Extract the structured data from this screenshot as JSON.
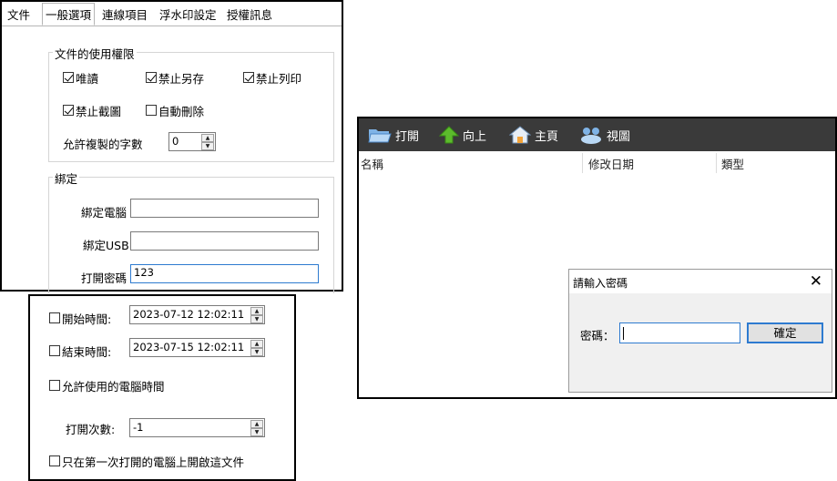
{
  "settings": {
    "tabs": [
      {
        "label": "文件"
      },
      {
        "label": "一般選項"
      },
      {
        "label": "連線項目"
      },
      {
        "label": "浮水印設定"
      },
      {
        "label": "授權訊息"
      }
    ],
    "active_tab": "一般選項",
    "permissions": {
      "legend": "文件的使用權限",
      "read_only": {
        "label": "唯讀",
        "checked": true
      },
      "no_save_as": {
        "label": "禁止另存",
        "checked": true
      },
      "no_print": {
        "label": "禁止列印",
        "checked": true
      },
      "no_screenshot": {
        "label": "禁止截圖",
        "checked": true
      },
      "auto_delete": {
        "label": "自動刪除",
        "checked": false
      },
      "copy_chars_label": "允許複製的字數",
      "copy_chars_value": "0"
    },
    "binding": {
      "legend": "綁定",
      "bind_pc_label": "綁定電腦",
      "bind_pc_value": "",
      "bind_usb_label": "綁定USB",
      "bind_usb_value": "",
      "open_pw_label": "打開密碼",
      "open_pw_value": "123"
    }
  },
  "time_panel": {
    "start_label": "開始時間:",
    "start_value": "2023-07-12 12:02:11",
    "start_checked": false,
    "end_label": "結束時間:",
    "end_value": "2023-07-15 12:02:11",
    "end_checked": false,
    "allow_pc_time_label": "允許使用的電腦時間",
    "allow_pc_time_checked": false,
    "open_count_label": "打開次數:",
    "open_count_value": "-1",
    "first_pc_only_label": "只在第一次打開的電腦上開啟這文件",
    "first_pc_only_checked": false
  },
  "browser": {
    "toolbar": {
      "open_label": "打開",
      "up_label": "向上",
      "home_label": "主頁",
      "view_label": "視圖"
    },
    "columns": [
      "名稱",
      "修改日期",
      "類型"
    ],
    "colors": {
      "toolbar_bg": "#3a3a3a",
      "accent": "#2e7bd0"
    }
  },
  "dialog": {
    "title": "請輸入密碼",
    "password_label": "密碼：",
    "password_value": "",
    "ok_label": "確定"
  }
}
